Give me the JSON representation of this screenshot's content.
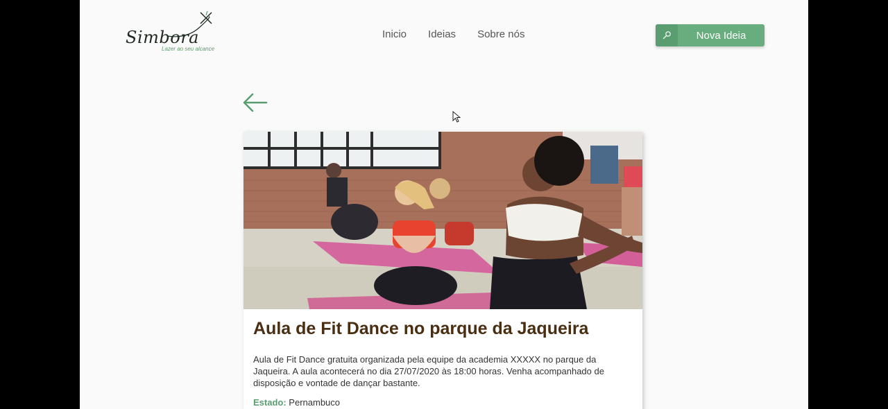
{
  "brand": {
    "name": "Simbora",
    "tagline": "Lazer ao seu alcance"
  },
  "nav": {
    "items": [
      "Inicio",
      "Ideias",
      "Sobre nós"
    ]
  },
  "header": {
    "new_idea_label": "Nova Ideia"
  },
  "event": {
    "title": "Aula de Fit Dance no parque da Jaqueira",
    "description": "Aula de Fit Dance gratuita organizada pela equipe da academia XXXXX no parque da Jaqueira. A aula acontecerá no dia 27/07/2020 às 18:00 horas. Venha acompanhado de disposição e vontade de dançar bastante.",
    "state_label": "Estado:",
    "state_value": "Pernambuco"
  },
  "colors": {
    "accent": "#67ad7e",
    "title": "#4a2e12"
  }
}
